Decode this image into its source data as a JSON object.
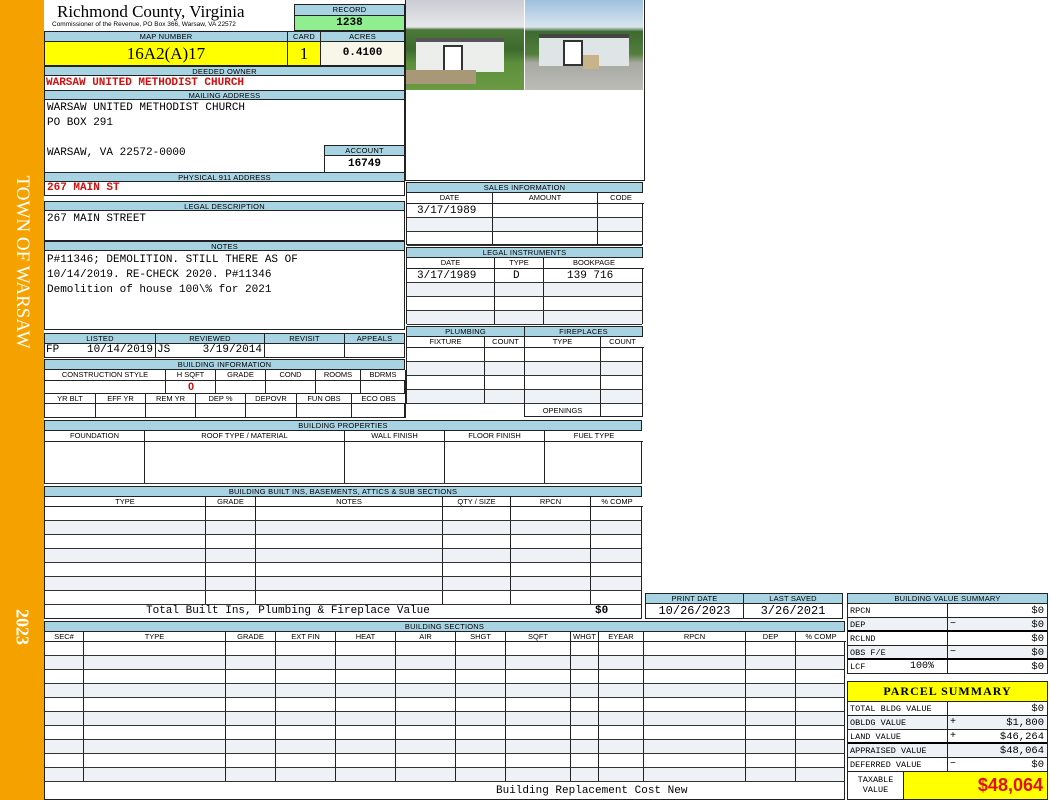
{
  "sidebar": {
    "town": "TOWN OF WARSAW",
    "year": "2023",
    "color": "#f5a200"
  },
  "header": {
    "county": "Richmond County, Virginia",
    "commissioner": "Commissioner of the Revenue, PO Box 366, Warsaw, VA 22572",
    "record_label": "RECORD",
    "record": "1238"
  },
  "parcel": {
    "map_label": "MAP NUMBER",
    "map": "16A2(A)17",
    "card_label": "CARD",
    "card": "1",
    "acres_label": "ACRES",
    "acres": "0.4100"
  },
  "owner": {
    "label": "DEEDED OWNER",
    "name": "WARSAW UNITED METHODIST CHURCH"
  },
  "mailing": {
    "label": "MAILING ADDRESS",
    "line1": "WARSAW UNITED METHODIST CHURCH",
    "line2": "PO BOX 291",
    "line3": "WARSAW, VA 22572-0000",
    "account_label": "ACCOUNT",
    "account": "16749"
  },
  "physical": {
    "label": "PHYSICAL 911 ADDRESS",
    "value": "267 MAIN ST"
  },
  "legal": {
    "label": "LEGAL DESCRIPTION",
    "value": "267 MAIN STREET"
  },
  "notes": {
    "label": "NOTES",
    "lines": [
      "P#11346; DEMOLITION. STILL THERE AS OF",
      "10/14/2019. RE-CHECK 2020. P#11346",
      "Demolition of house 100\\% for 2021"
    ]
  },
  "review": {
    "listed_label": "LISTED",
    "listed_by": "FP",
    "listed": "10/14/2019",
    "reviewed_label": "REVIEWED",
    "reviewed_by": "JS",
    "reviewed": "3/19/2014",
    "revisit_label": "REVISIT",
    "appeals_label": "APPEALS"
  },
  "building_info": {
    "label": "BUILDING INFORMATION",
    "cols1": [
      "CONSTRUCTION STYLE",
      "H SQFT",
      "GRADE",
      "COND",
      "ROOMS",
      "BDRMS"
    ],
    "hsqft": "0",
    "cols2": [
      "YR BLT",
      "EFF YR",
      "REM YR",
      "DEP %",
      "DEPOVR",
      "FUN OBS",
      "ECO OBS"
    ]
  },
  "sales": {
    "label": "SALES INFORMATION",
    "cols": [
      "DATE",
      "AMOUNT",
      "CODE"
    ],
    "rows": [
      {
        "date": "3/17/1989"
      }
    ]
  },
  "instruments": {
    "label": "LEGAL INSTRUMENTS",
    "cols": [
      "DATE",
      "TYPE",
      "BOOKPAGE"
    ],
    "rows": [
      {
        "date": "3/17/1989",
        "type": "D",
        "bookpage": "139 716"
      }
    ]
  },
  "plumbing": {
    "label": "PLUMBING",
    "cols": [
      "FIXTURE",
      "COUNT"
    ]
  },
  "fireplaces": {
    "label": "FIREPLACES",
    "cols": [
      "TYPE",
      "COUNT"
    ],
    "openings": "OPENINGS"
  },
  "properties": {
    "label": "BUILDING PROPERTIES",
    "cols": [
      "FOUNDATION",
      "ROOF TYPE / MATERIAL",
      "WALL FINISH",
      "FLOOR FINISH",
      "FUEL TYPE"
    ]
  },
  "builtins": {
    "label": "BUILDING BUILT INS, BASEMENTS, ATTICS & SUB SECTIONS",
    "cols": [
      "TYPE",
      "GRADE",
      "NOTES",
      "QTY / SIZE",
      "RPCN",
      "% COMP"
    ],
    "total_label": "Total Built Ins, Plumbing & Fireplace Value",
    "total": "$0"
  },
  "dates": {
    "print_label": "PRINT DATE",
    "print": "10/26/2023",
    "saved_label": "LAST SAVED",
    "saved": "3/26/2021"
  },
  "sections": {
    "label": "BUILDING SECTIONS",
    "cols": [
      "SEC#",
      "TYPE",
      "GRADE",
      "EXT FIN",
      "HEAT",
      "AIR",
      "SHGT",
      "SQFT",
      "WHGT",
      "EYEAR",
      "RPCN",
      "DEP",
      "% COMP"
    ],
    "footer": "Building Replacement Cost New"
  },
  "value_summary": {
    "label": "BUILDING VALUE SUMMARY",
    "rows": [
      {
        "label": "RPCN",
        "sign": "",
        "value": "$0"
      },
      {
        "label": "DEP",
        "sign": "−",
        "value": "$0"
      },
      {
        "label": "RCLND",
        "sign": "",
        "value": "$0"
      },
      {
        "label": "OBS F/E",
        "sign": "−",
        "value": "$0"
      },
      {
        "label": "LCF",
        "extra": "100%",
        "sign": "",
        "value": "$0"
      }
    ]
  },
  "parcel_summary": {
    "label": "PARCEL SUMMARY",
    "rows": [
      {
        "label": "TOTAL BLDG VALUE",
        "sign": "",
        "value": "$0"
      },
      {
        "label": "OBLDG VALUE",
        "sign": "+",
        "value": "$1,800"
      },
      {
        "label": "LAND VALUE",
        "sign": "+",
        "value": "$46,264"
      },
      {
        "label": "APPRAISED VALUE",
        "sign": "",
        "value": "$48,064"
      },
      {
        "label": "DEFERRED VALUE",
        "sign": "−",
        "value": "$0"
      }
    ],
    "taxable_label": "TAXABLE VALUE",
    "taxable": "$48,064"
  }
}
